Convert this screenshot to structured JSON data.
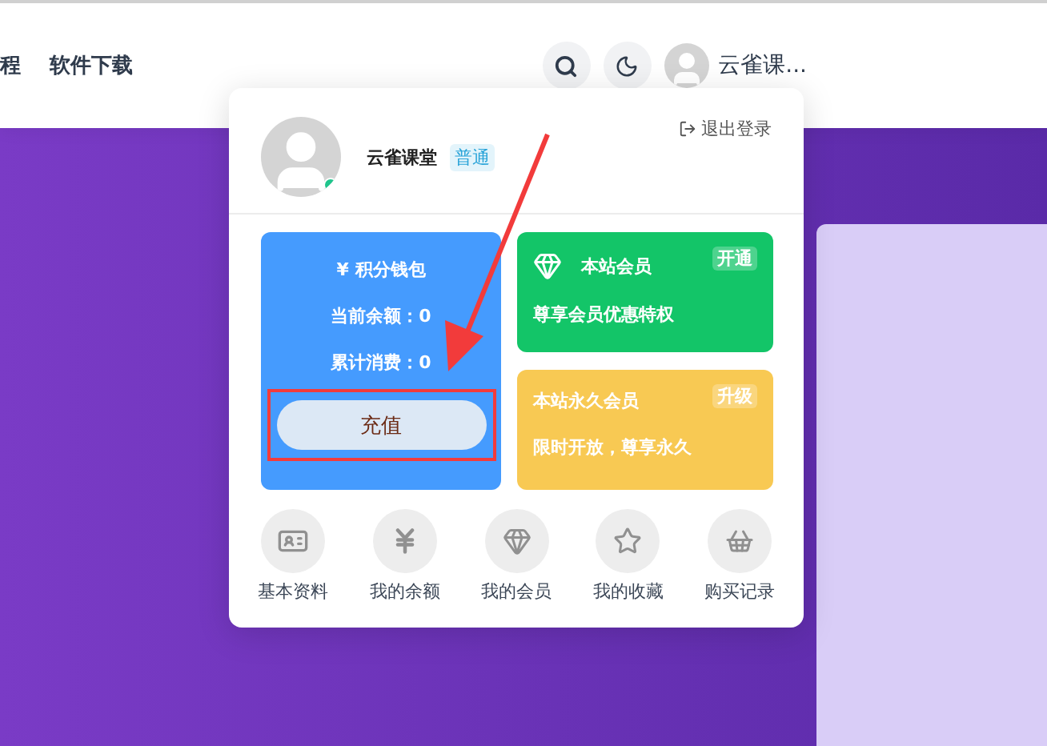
{
  "nav": {
    "links": [
      "程",
      "软件下载"
    ],
    "user_name": "云雀课..."
  },
  "popup": {
    "user": {
      "name": "云雀课堂",
      "level": "普通",
      "online": true
    },
    "logout": "退出登录",
    "wallet": {
      "title": "积分钱包",
      "currency": "¥",
      "balance": "当前余额：0",
      "spent": "累计消费：0",
      "button": "充值"
    },
    "member_cards": [
      {
        "kind": "green",
        "title": "本站会员",
        "badge": "开通",
        "desc": "尊享会员优惠特权"
      },
      {
        "kind": "yellow",
        "title": "本站永久会员",
        "badge": "升级",
        "desc": "限时开放，尊享永久"
      }
    ],
    "shortcuts": [
      {
        "label": "基本资料"
      },
      {
        "label": "我的余额"
      },
      {
        "label": "我的会员"
      },
      {
        "label": "我的收藏"
      },
      {
        "label": "购买记录"
      }
    ]
  },
  "annotation": {
    "highlight": true
  }
}
